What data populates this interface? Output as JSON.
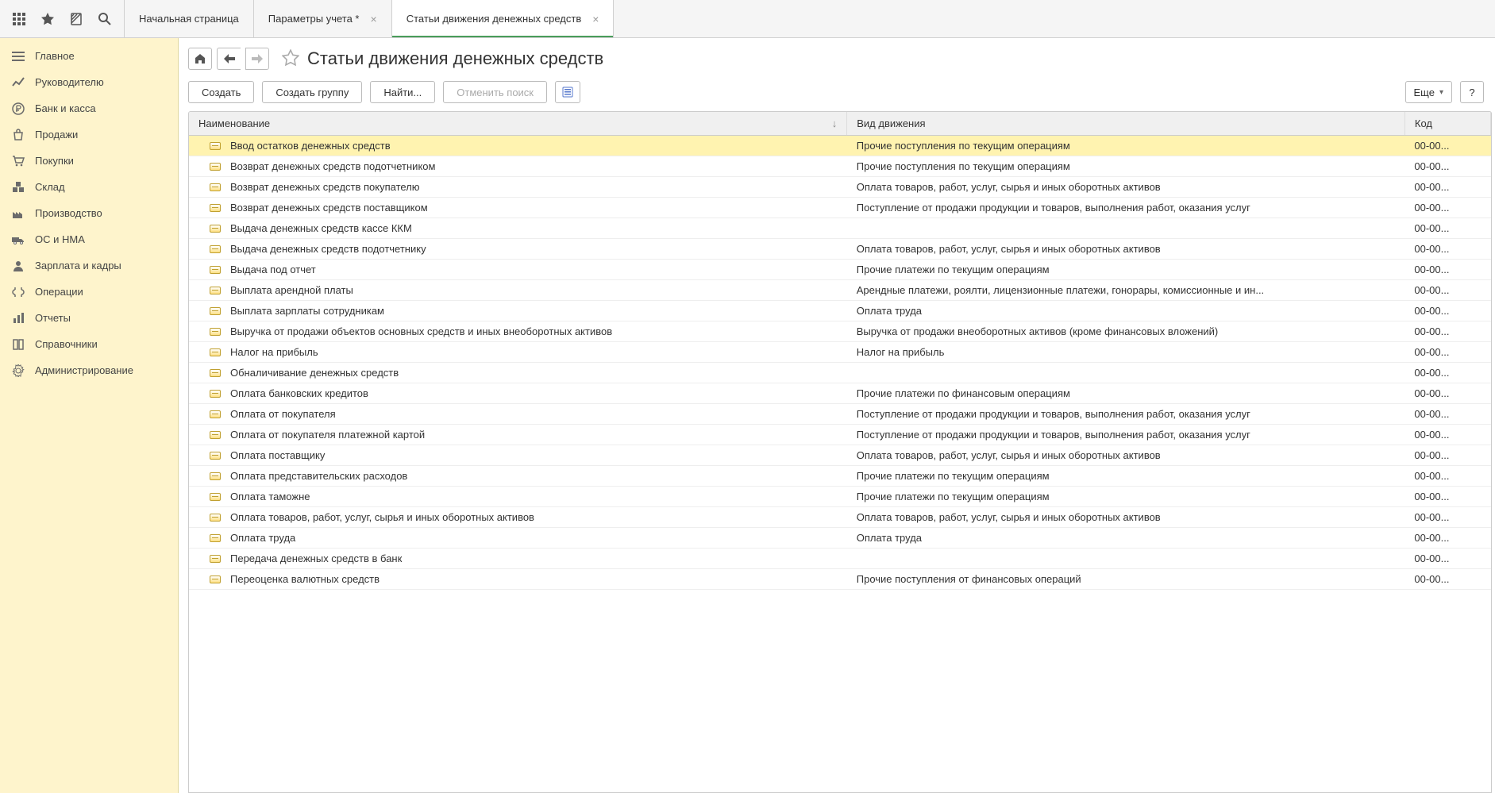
{
  "tabs": [
    {
      "label": "Начальная страница",
      "closable": false
    },
    {
      "label": "Параметры учета *",
      "closable": true
    },
    {
      "label": "Статьи движения денежных средств",
      "closable": true,
      "active": true
    }
  ],
  "sidebar": [
    {
      "label": "Главное",
      "icon": "menu"
    },
    {
      "label": "Руководителю",
      "icon": "trend"
    },
    {
      "label": "Банк и касса",
      "icon": "ruble"
    },
    {
      "label": "Продажи",
      "icon": "bag"
    },
    {
      "label": "Покупки",
      "icon": "cart"
    },
    {
      "label": "Склад",
      "icon": "boxes"
    },
    {
      "label": "Производство",
      "icon": "factory"
    },
    {
      "label": "ОС и НМА",
      "icon": "truck"
    },
    {
      "label": "Зарплата и кадры",
      "icon": "person"
    },
    {
      "label": "Операции",
      "icon": "ops"
    },
    {
      "label": "Отчеты",
      "icon": "chart"
    },
    {
      "label": "Справочники",
      "icon": "book"
    },
    {
      "label": "Администрирование",
      "icon": "gear"
    }
  ],
  "page": {
    "title": "Статьи движения денежных средств"
  },
  "toolbar": {
    "create": "Создать",
    "create_group": "Создать группу",
    "find": "Найти...",
    "cancel_find": "Отменить поиск",
    "more": "Еще",
    "help": "?"
  },
  "table": {
    "cols": {
      "name": "Наименование",
      "type": "Вид движения",
      "code": "Код"
    },
    "rows": [
      {
        "name": "Ввод остатков денежных средств",
        "type": "Прочие поступления по текущим операциям",
        "code": "00-00...",
        "sel": true
      },
      {
        "name": "Возврат денежных средств подотчетником",
        "type": "Прочие поступления по текущим операциям",
        "code": "00-00..."
      },
      {
        "name": "Возврат денежных средств покупателю",
        "type": "Оплата товаров, работ, услуг, сырья и иных оборотных активов",
        "code": "00-00..."
      },
      {
        "name": "Возврат денежных средств поставщиком",
        "type": "Поступление от продажи продукции и товаров, выполнения работ, оказания услуг",
        "code": "00-00..."
      },
      {
        "name": "Выдача денежных средств кассе ККМ",
        "type": "",
        "code": "00-00..."
      },
      {
        "name": "Выдача денежных средств подотчетнику",
        "type": "Оплата товаров, работ, услуг, сырья и иных оборотных активов",
        "code": "00-00..."
      },
      {
        "name": "Выдача под отчет",
        "type": "Прочие платежи по текущим операциям",
        "code": "00-00..."
      },
      {
        "name": "Выплата арендной платы",
        "type": "Арендные платежи, роялти, лицензионные платежи, гонорары, комиссионные и ин...",
        "code": "00-00..."
      },
      {
        "name": "Выплата зарплаты сотрудникам",
        "type": "Оплата труда",
        "code": "00-00..."
      },
      {
        "name": "Выручка от продажи объектов основных средств и иных внеоборотных активов",
        "type": "Выручка от продажи внеоборотных активов (кроме финансовых вложений)",
        "code": "00-00..."
      },
      {
        "name": "Налог на прибыль",
        "type": "Налог на прибыль",
        "code": "00-00..."
      },
      {
        "name": "Обналичивание денежных средств",
        "type": "",
        "code": "00-00..."
      },
      {
        "name": "Оплата банковских кредитов",
        "type": "Прочие платежи по финансовым операциям",
        "code": "00-00..."
      },
      {
        "name": "Оплата от покупателя",
        "type": "Поступление от продажи продукции и товаров, выполнения работ, оказания услуг",
        "code": "00-00..."
      },
      {
        "name": "Оплата от покупателя платежной картой",
        "type": "Поступление от продажи продукции и товаров, выполнения работ, оказания услуг",
        "code": "00-00..."
      },
      {
        "name": "Оплата поставщику",
        "type": "Оплата товаров, работ, услуг, сырья и иных оборотных активов",
        "code": "00-00..."
      },
      {
        "name": "Оплата представительских расходов",
        "type": "Прочие платежи по текущим операциям",
        "code": "00-00..."
      },
      {
        "name": "Оплата таможне",
        "type": "Прочие платежи по текущим операциям",
        "code": "00-00..."
      },
      {
        "name": "Оплата товаров, работ, услуг, сырья и иных оборотных активов",
        "type": "Оплата товаров, работ, услуг, сырья и иных оборотных активов",
        "code": "00-00..."
      },
      {
        "name": "Оплата труда",
        "type": "Оплата труда",
        "code": "00-00..."
      },
      {
        "name": "Передача денежных средств в банк",
        "type": "",
        "code": "00-00..."
      },
      {
        "name": "Переоценка валютных средств",
        "type": "Прочие поступления от финансовых операций",
        "code": "00-00..."
      }
    ]
  }
}
